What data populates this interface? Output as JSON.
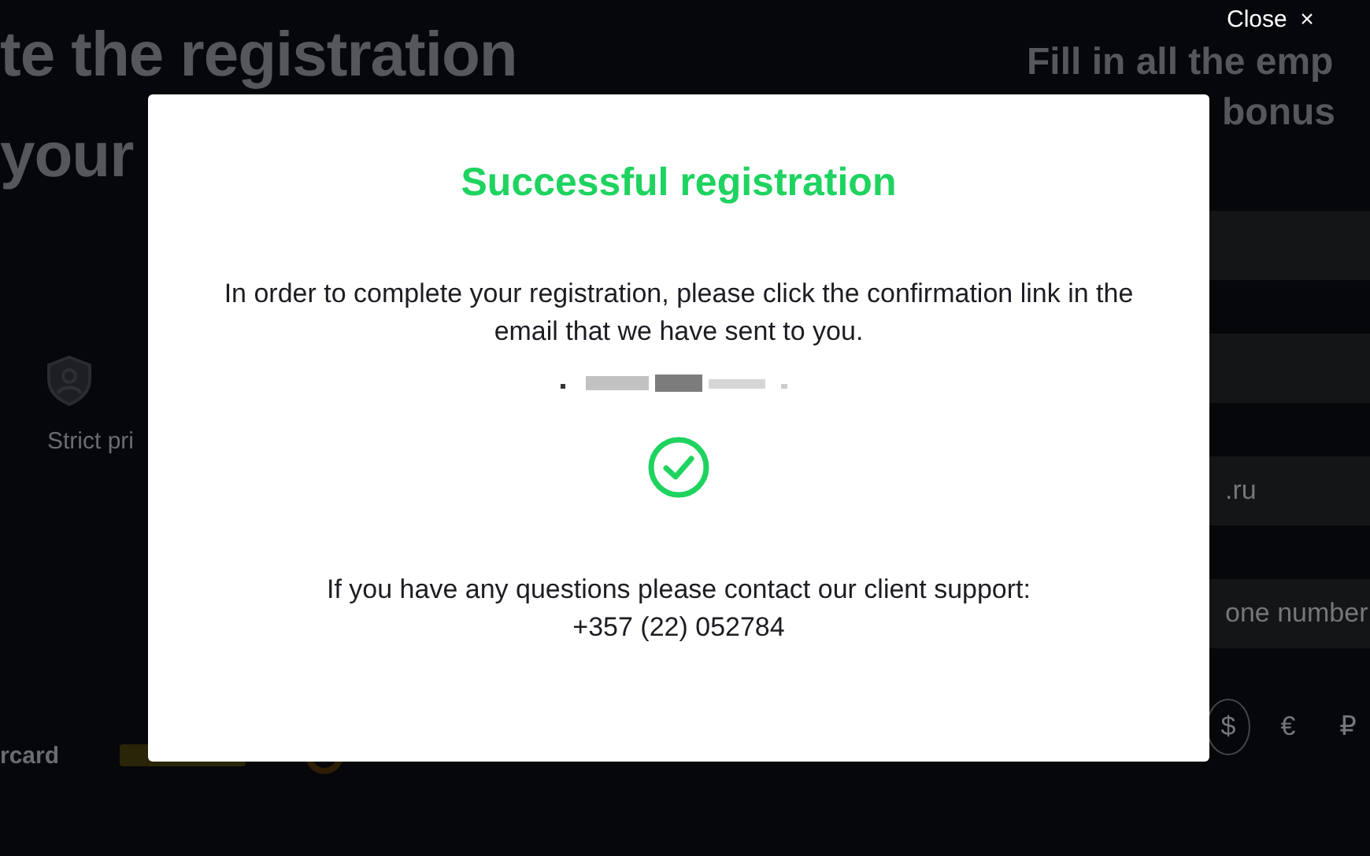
{
  "background_page": {
    "heading_lines": [
      "te the registration",
      "your"
    ],
    "feature": {
      "label": "Strict pri"
    },
    "payment_label": "rcard",
    "form_heading_lines": [
      "Fill in all the emp",
      "bonus"
    ],
    "fields": [
      {
        "kind": "blank"
      },
      {
        "kind": "blank"
      },
      {
        "kind": "text",
        "text": ".ru"
      },
      {
        "kind": "text",
        "text": "one number"
      }
    ],
    "currencies": [
      {
        "symbol": "$",
        "selected": true
      },
      {
        "symbol": "€",
        "selected": false
      },
      {
        "symbol": "₽",
        "selected": false
      }
    ]
  },
  "close_button": {
    "label": "Close",
    "icon": "×"
  },
  "modal": {
    "title": "Successful registration",
    "message": "In order to complete your registration, please click the confirmation link in the email that we have sent to you.",
    "support_text": "If you have any questions please contact our client support:",
    "phone": "+357 (22) 052784"
  }
}
